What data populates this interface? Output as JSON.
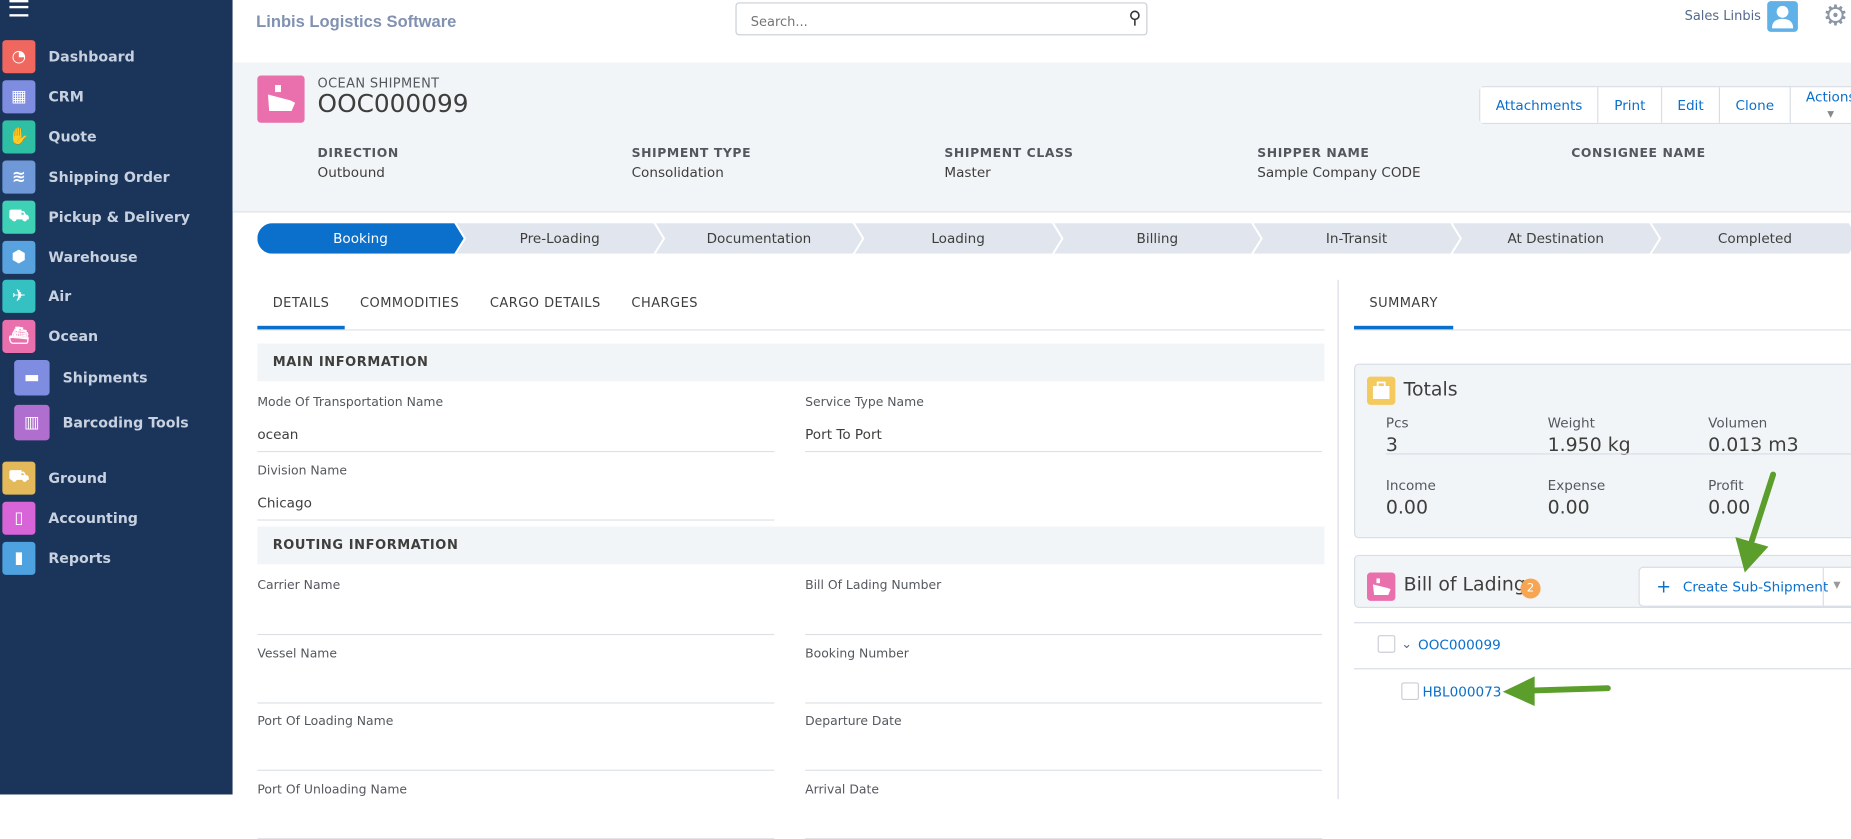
{
  "app_title": "Linbis Logistics Software",
  "search": {
    "placeholder": "Search..."
  },
  "user": {
    "name": "Sales Linbis"
  },
  "sidebar": {
    "items": [
      {
        "label": "Dashboard",
        "color": "#f0675f",
        "icon": "dashboard-icon"
      },
      {
        "label": "CRM",
        "color": "#7f8de1",
        "icon": "building-icon"
      },
      {
        "label": "Quote",
        "color": "#2fbfa4",
        "icon": "handshake-icon"
      },
      {
        "label": "Shipping Order",
        "color": "#6f98d8",
        "icon": "layers-icon"
      },
      {
        "label": "Pickup & Delivery",
        "color": "#3fd1b6",
        "icon": "truck-icon"
      },
      {
        "label": "Warehouse",
        "color": "#59a2e0",
        "icon": "box-icon"
      },
      {
        "label": "Air",
        "color": "#35c1c1",
        "icon": "plane-icon"
      },
      {
        "label": "Ocean",
        "color": "#ea6fad",
        "icon": "ship-icon"
      },
      {
        "label": "Shipments",
        "color": "#7f8de1",
        "icon": "folder-icon"
      },
      {
        "label": "Barcoding Tools",
        "color": "#b06fcf",
        "icon": "barcode-icon"
      },
      {
        "label": "Ground",
        "color": "#e3b95a",
        "icon": "truck-icon"
      },
      {
        "label": "Accounting",
        "color": "#d865d8",
        "icon": "book-icon"
      },
      {
        "label": "Reports",
        "color": "#4ea2df",
        "icon": "chart-icon"
      }
    ]
  },
  "record": {
    "kind": "OCEAN SHIPMENT",
    "number": "OOC000099",
    "actions": [
      "Attachments",
      "Print",
      "Edit",
      "Clone",
      "Actions"
    ],
    "fields": [
      {
        "label": "DIRECTION",
        "value": "Outbound"
      },
      {
        "label": "SHIPMENT TYPE",
        "value": "Consolidation"
      },
      {
        "label": "SHIPMENT CLASS",
        "value": "Master"
      },
      {
        "label": "SHIPPER NAME",
        "value": "Sample Company CODE"
      },
      {
        "label": "CONSIGNEE NAME",
        "value": ""
      }
    ]
  },
  "path": {
    "steps": [
      "Booking",
      "Pre-Loading",
      "Documentation",
      "Loading",
      "Billing",
      "In-Transit",
      "At Destination",
      "Completed"
    ],
    "active": "Booking"
  },
  "tabs": [
    "DETAILS",
    "COMMODITIES",
    "CARGO DETAILS",
    "CHARGES"
  ],
  "main_info": {
    "title": "MAIN INFORMATION",
    "fields": [
      {
        "label": "Mode Of Transportation Name",
        "value": "ocean"
      },
      {
        "label": "Service Type Name",
        "value": "Port To Port"
      },
      {
        "label": "Division Name",
        "value": "Chicago"
      }
    ]
  },
  "routing": {
    "title": "ROUTING INFORMATION",
    "fields": [
      {
        "label": "Carrier Name",
        "value": ""
      },
      {
        "label": "Bill Of Lading Number",
        "value": ""
      },
      {
        "label": "Vessel Name",
        "value": ""
      },
      {
        "label": "Booking Number",
        "value": ""
      },
      {
        "label": "Port Of Loading Name",
        "value": ""
      },
      {
        "label": "Departure Date",
        "value": ""
      },
      {
        "label": "Port Of Unloading Name",
        "value": ""
      },
      {
        "label": "Arrival Date",
        "value": ""
      }
    ]
  },
  "summary": {
    "tab": "SUMMARY",
    "totals": {
      "title": "Totals",
      "items": [
        {
          "label": "Pcs",
          "value": "3"
        },
        {
          "label": "Weight",
          "value": "1.950 kg"
        },
        {
          "label": "Volumen",
          "value": "0.013 m3"
        },
        {
          "label": "Income",
          "value": "0.00"
        },
        {
          "label": "Expense",
          "value": "0.00"
        },
        {
          "label": "Profit",
          "value": "0.00"
        }
      ]
    },
    "bols": {
      "title": "Bill of Ladings",
      "count": "2",
      "create_label": "Create Sub-Shipment",
      "plus": "+",
      "rows": [
        {
          "number": "OOC000099"
        },
        {
          "number": "HBL000073"
        }
      ]
    }
  }
}
